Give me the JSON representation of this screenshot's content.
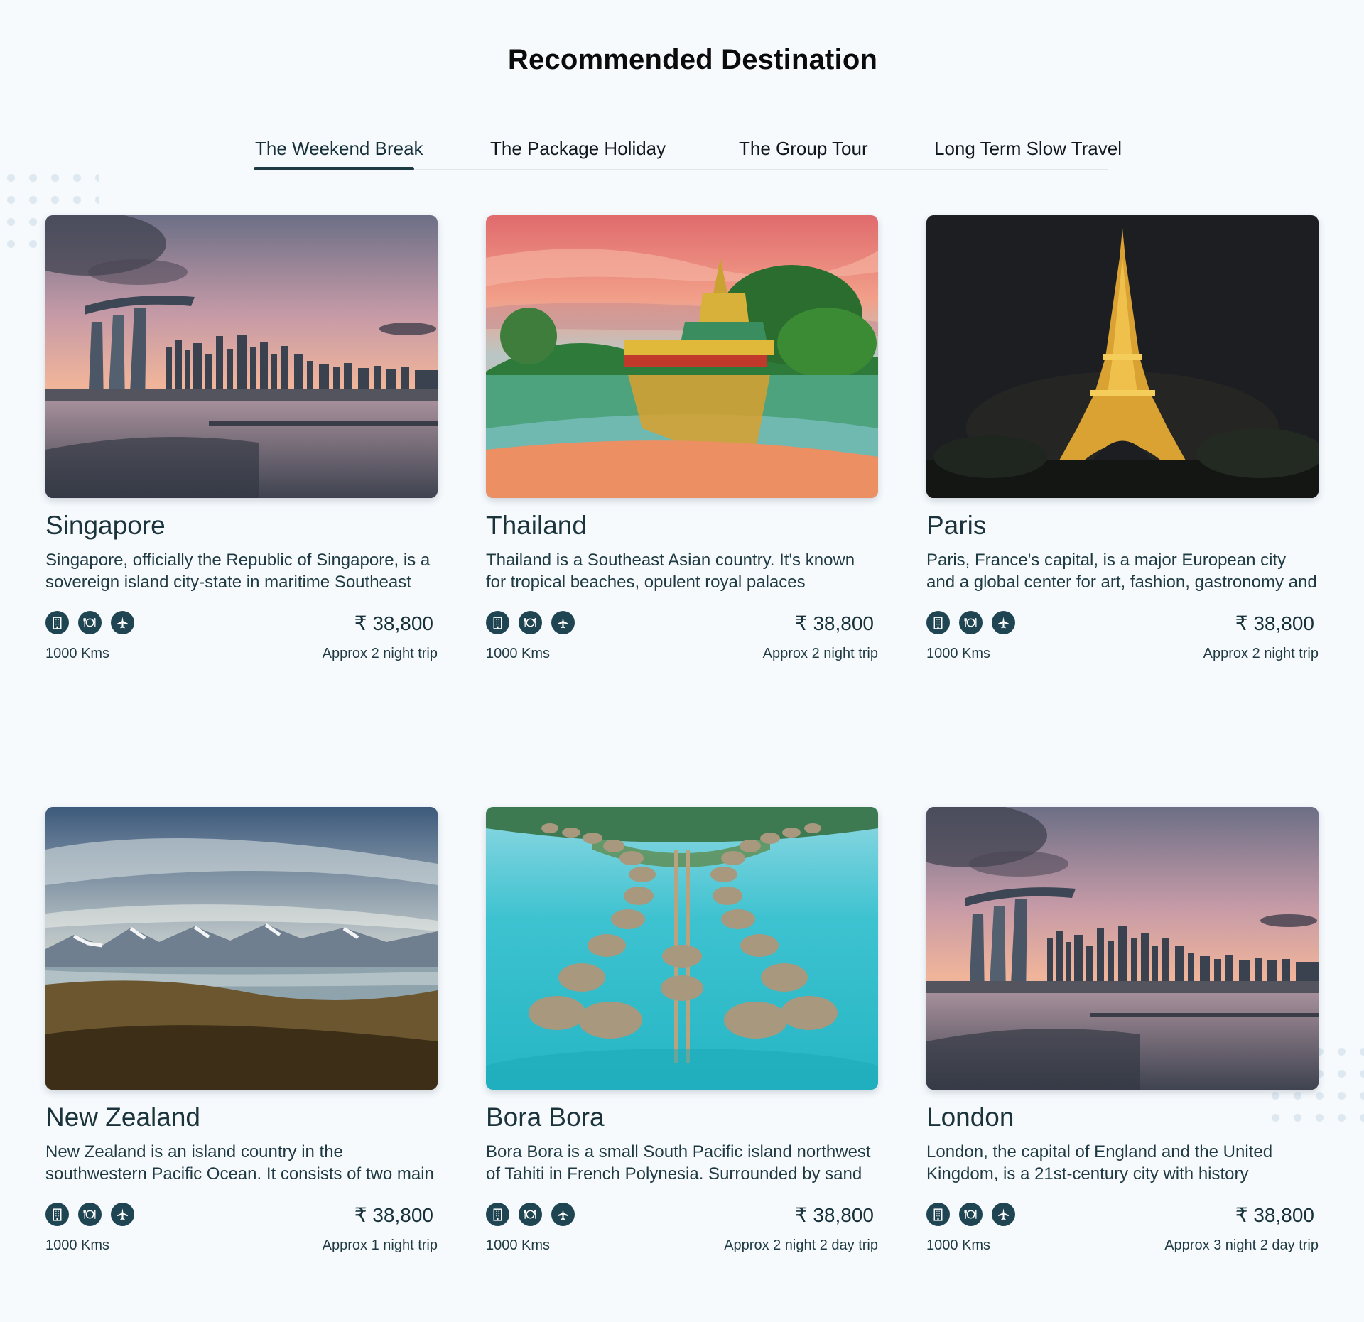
{
  "page_title": "Recommended Destination",
  "tabs": [
    {
      "label": "The Weekend Break",
      "active": true
    },
    {
      "label": "The Package Holiday",
      "active": false
    },
    {
      "label": "The Group Tour",
      "active": false
    },
    {
      "label": "Long Term Slow Travel",
      "active": false
    }
  ],
  "colors": {
    "accent": "#1e3b44",
    "icon_bg": "#1f4452",
    "background": "#f6fafd"
  },
  "amenity_icons": [
    "hotel-icon",
    "dining-icon",
    "flight-icon"
  ],
  "cards": [
    {
      "name": "Singapore",
      "description": "Singapore, officially the Republic of Singapore, is a sovereign island city-state in maritime Southeast",
      "price": "₹ 38,800",
      "distance": "1000 Kms",
      "trip": "Approx 2 night trip"
    },
    {
      "name": "Thailand",
      "description": "Thailand is a Southeast Asian country. It's known for tropical beaches, opulent royal palaces",
      "price": "₹ 38,800",
      "distance": "1000 Kms",
      "trip": "Approx 2 night trip"
    },
    {
      "name": "Paris",
      "description": "Paris, France's capital, is a major European city and a global center for art, fashion, gastronomy and",
      "price": "₹ 38,800",
      "distance": "1000 Kms",
      "trip": "Approx 2 night trip"
    },
    {
      "name": "New Zealand",
      "description": "New Zealand is an island country in the southwestern Pacific Ocean. It consists of two main",
      "price": "₹ 38,800",
      "distance": "1000 Kms",
      "trip": "Approx 1 night trip"
    },
    {
      "name": "Bora Bora",
      "description": "Bora Bora is a small South Pacific island northwest of Tahiti in French Polynesia. Surrounded by sand",
      "price": "₹ 38,800",
      "distance": "1000 Kms",
      "trip": "Approx 2 night 2 day trip"
    },
    {
      "name": "London",
      "description": "London, the capital of England and the United Kingdom, is a 21st-century city with history",
      "price": "₹ 38,800",
      "distance": "1000 Kms",
      "trip": "Approx 3 night 2 day trip"
    }
  ]
}
